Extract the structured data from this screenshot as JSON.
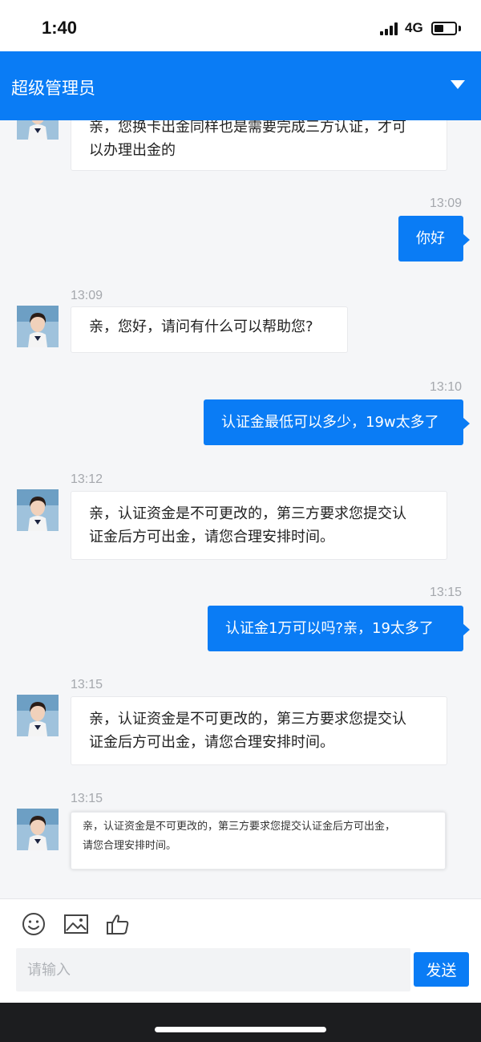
{
  "status_bar": {
    "time": "1:40",
    "network": "4G",
    "battery_level": 0.45
  },
  "header": {
    "title": "超级管理员",
    "dropdown_icon": "caret-down-icon"
  },
  "messages": [
    {
      "side": "in",
      "time": "",
      "lines": [
        "亲，您换卡出金同样也是需要完成三方认证，才可",
        "以办理出金的"
      ]
    },
    {
      "side": "out",
      "time": "13:09",
      "text": "你好"
    },
    {
      "side": "in",
      "time": "13:09",
      "lines": [
        "亲，您好，请问有什么可以帮助您?"
      ]
    },
    {
      "side": "out",
      "time": "13:10",
      "text": "认证金最低可以多少，19w太多了"
    },
    {
      "side": "in",
      "time": "13:12",
      "lines": [
        "亲，认证资金是不可更改的，第三方要求您提交认",
        "证金后方可出金，请您合理安排时间。"
      ]
    },
    {
      "side": "out",
      "time": "13:15",
      "text": "认证金1万可以吗?亲，19太多了"
    },
    {
      "side": "in",
      "time": "13:15",
      "lines": [
        "亲，认证资金是不可更改的，第三方要求您提交认",
        "证金后方可出金，请您合理安排时间。"
      ]
    },
    {
      "side": "in-image",
      "time": "13:15",
      "lines": [
        "亲，认证资金是不可更改的，第三方要求您提交认证金后方可出金，",
        "请您合理安排时间。"
      ]
    }
  ],
  "toolbar": {
    "icons": [
      "emoji-icon",
      "image-icon",
      "thumbs-up-icon"
    ],
    "input_placeholder": "请输入",
    "send_label": "发送"
  },
  "colors": {
    "accent": "#0a7cf5",
    "background": "#f5f6f8"
  }
}
